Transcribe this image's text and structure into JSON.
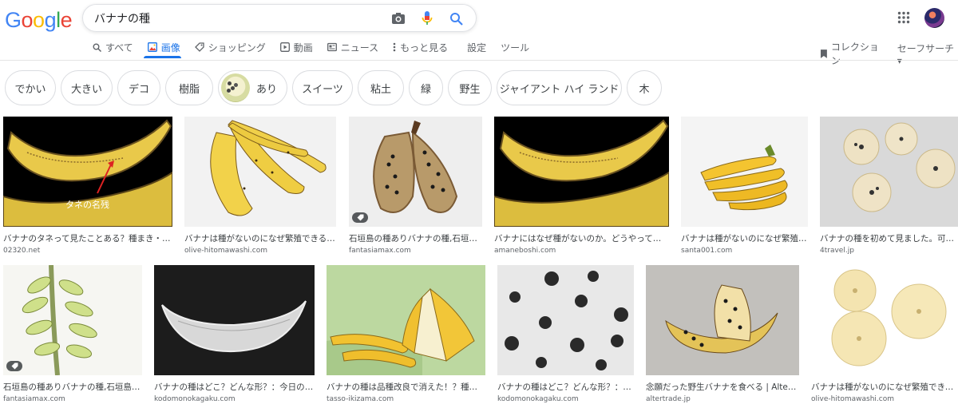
{
  "search": {
    "query": "バナナの種"
  },
  "tabs": [
    {
      "label": "すべて",
      "icon": "search-icon"
    },
    {
      "label": "画像",
      "icon": "image-icon",
      "active": true
    },
    {
      "label": "ショッピング",
      "icon": "tag-icon"
    },
    {
      "label": "動画",
      "icon": "play-icon"
    },
    {
      "label": "ニュース",
      "icon": "news-icon"
    },
    {
      "label": "もっと見る",
      "icon": "more-vert-icon"
    }
  ],
  "tools": {
    "settings": "設定",
    "tools": "ツール",
    "collection": "コレクション",
    "safesearch": "セーフサーチ▾"
  },
  "chips": [
    "でかい",
    "大きい",
    "デコ",
    "樹脂",
    "あり",
    "スイーツ",
    "粘土",
    "緑",
    "野生",
    "ジャイアント ハイ ランド",
    "木"
  ],
  "results": [
    {
      "caption": "バナナのタネって見たことある？種まき・育苗...",
      "source": "02320.net",
      "overlay": "タネの名残"
    },
    {
      "caption": "バナナは種がないのになぜ繁殖できるの...",
      "source": "olive-hitomawashi.com"
    },
    {
      "caption": "石垣島の種ありバナナの種,石垣島の...",
      "source": "fantasiamax.com"
    },
    {
      "caption": "バナナにはなぜ種がないのか。どうやって子孫...",
      "source": "amaneboshi.com"
    },
    {
      "caption": "バナナは種がないのになぜ繁殖で...",
      "source": "santa001.com"
    },
    {
      "caption": "バナナの種を初めて見ました。可愛...",
      "source": "4travel.jp"
    },
    {
      "caption": "石垣島の種ありバナナの種,石垣島の...",
      "source": "fantasiamax.com"
    },
    {
      "caption": "バナナの種はどこ？どんな形？：今日のはて...",
      "source": "kodomonokagaku.com"
    },
    {
      "caption": "バナナの種は品種改良で消えた！？種がなし...",
      "source": "tasso-ikizama.com"
    },
    {
      "caption": "バナナの種はどこ？どんな形？：今日...",
      "source": "kodomonokagaku.com"
    },
    {
      "caption": "念願だった野生バナナを食べる | Alter Tra...",
      "source": "altertrade.jp"
    },
    {
      "caption": "バナナは種がないのになぜ繁殖できる...",
      "source": "olive-hitomawashi.com"
    }
  ]
}
